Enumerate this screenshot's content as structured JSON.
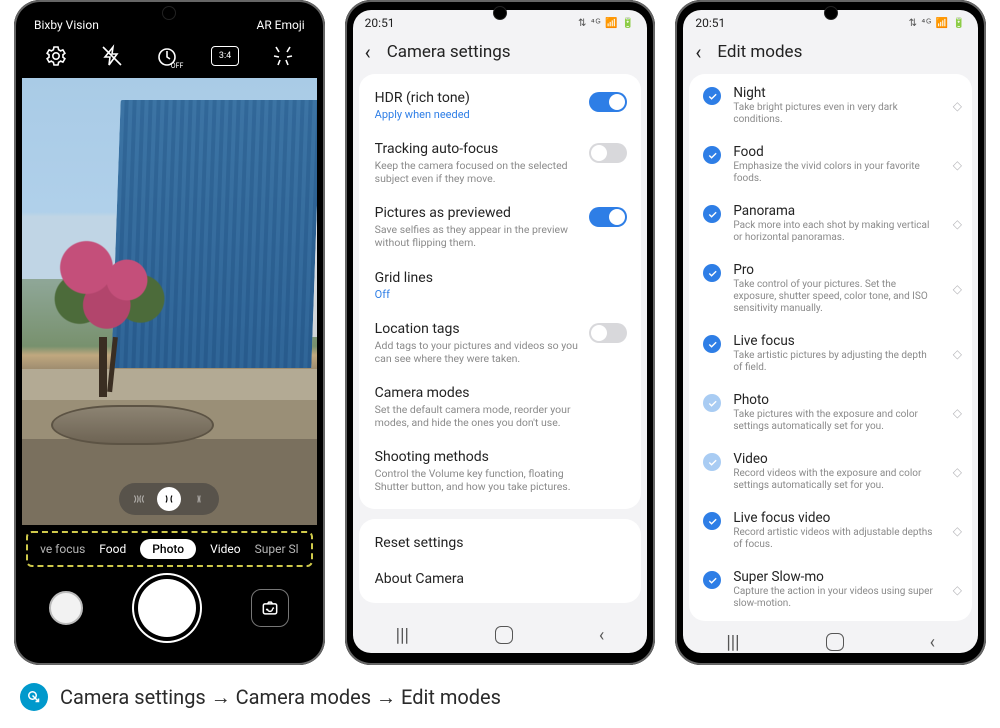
{
  "caption": {
    "text": "Camera settings → Camera modes → Edit modes"
  },
  "camera": {
    "topbar": {
      "left": "Bixby Vision",
      "right": "AR Emoji"
    },
    "icons": {
      "settings": "settings-icon",
      "flash": "flash-off-icon",
      "timer": "timer-off-icon",
      "ratio": "3:4",
      "effects": "effects-icon"
    },
    "modes": {
      "m0": "Live focus",
      "m1": "Food",
      "m2": "Photo",
      "m3": "Video",
      "m4": "Super Slow-mo"
    }
  },
  "status": {
    "time": "20:51"
  },
  "settings": {
    "title": "Camera settings",
    "items": {
      "hdr": {
        "t": "HDR (rich tone)",
        "s": "Apply when needed",
        "on": true
      },
      "track": {
        "t": "Tracking auto-focus",
        "s": "Keep the camera focused on the selected subject even if they move.",
        "on": false
      },
      "preview": {
        "t": "Pictures as previewed",
        "s": "Save selfies as they appear in the preview without flipping them.",
        "on": true
      },
      "grid": {
        "t": "Grid lines",
        "s": "Off"
      },
      "loc": {
        "t": "Location tags",
        "s": "Add tags to your pictures and videos so you can see where they were taken.",
        "on": false
      },
      "modes": {
        "t": "Camera modes",
        "s": "Set the default camera mode, reorder your modes, and hide the ones you don't use."
      },
      "shoot": {
        "t": "Shooting methods",
        "s": "Control the Volume key function, floating Shutter button, and how you take pictures."
      }
    },
    "reset": "Reset settings",
    "about": "About Camera"
  },
  "edit": {
    "title": "Edit modes",
    "items": [
      {
        "t": "Night",
        "s": "Take bright pictures even in very dark conditions.",
        "dim": false
      },
      {
        "t": "Food",
        "s": "Emphasize the vivid colors in your favorite foods.",
        "dim": false
      },
      {
        "t": "Panorama",
        "s": "Pack more into each shot by making vertical or horizontal panoramas.",
        "dim": false
      },
      {
        "t": "Pro",
        "s": "Take control of your pictures. Set the exposure, shutter speed, color tone, and ISO sensitivity manually.",
        "dim": false
      },
      {
        "t": "Live focus",
        "s": "Take artistic pictures by adjusting the depth of field.",
        "dim": false
      },
      {
        "t": "Photo",
        "s": "Take pictures with the exposure and color settings automatically set for you.",
        "dim": true
      },
      {
        "t": "Video",
        "s": "Record videos with the exposure and color settings automatically set for you.",
        "dim": true
      },
      {
        "t": "Live focus video",
        "s": "Record artistic videos with adjustable depths of focus.",
        "dim": false
      },
      {
        "t": "Super Slow-mo",
        "s": "Capture the action in your videos using super slow-motion.",
        "dim": false
      }
    ]
  }
}
